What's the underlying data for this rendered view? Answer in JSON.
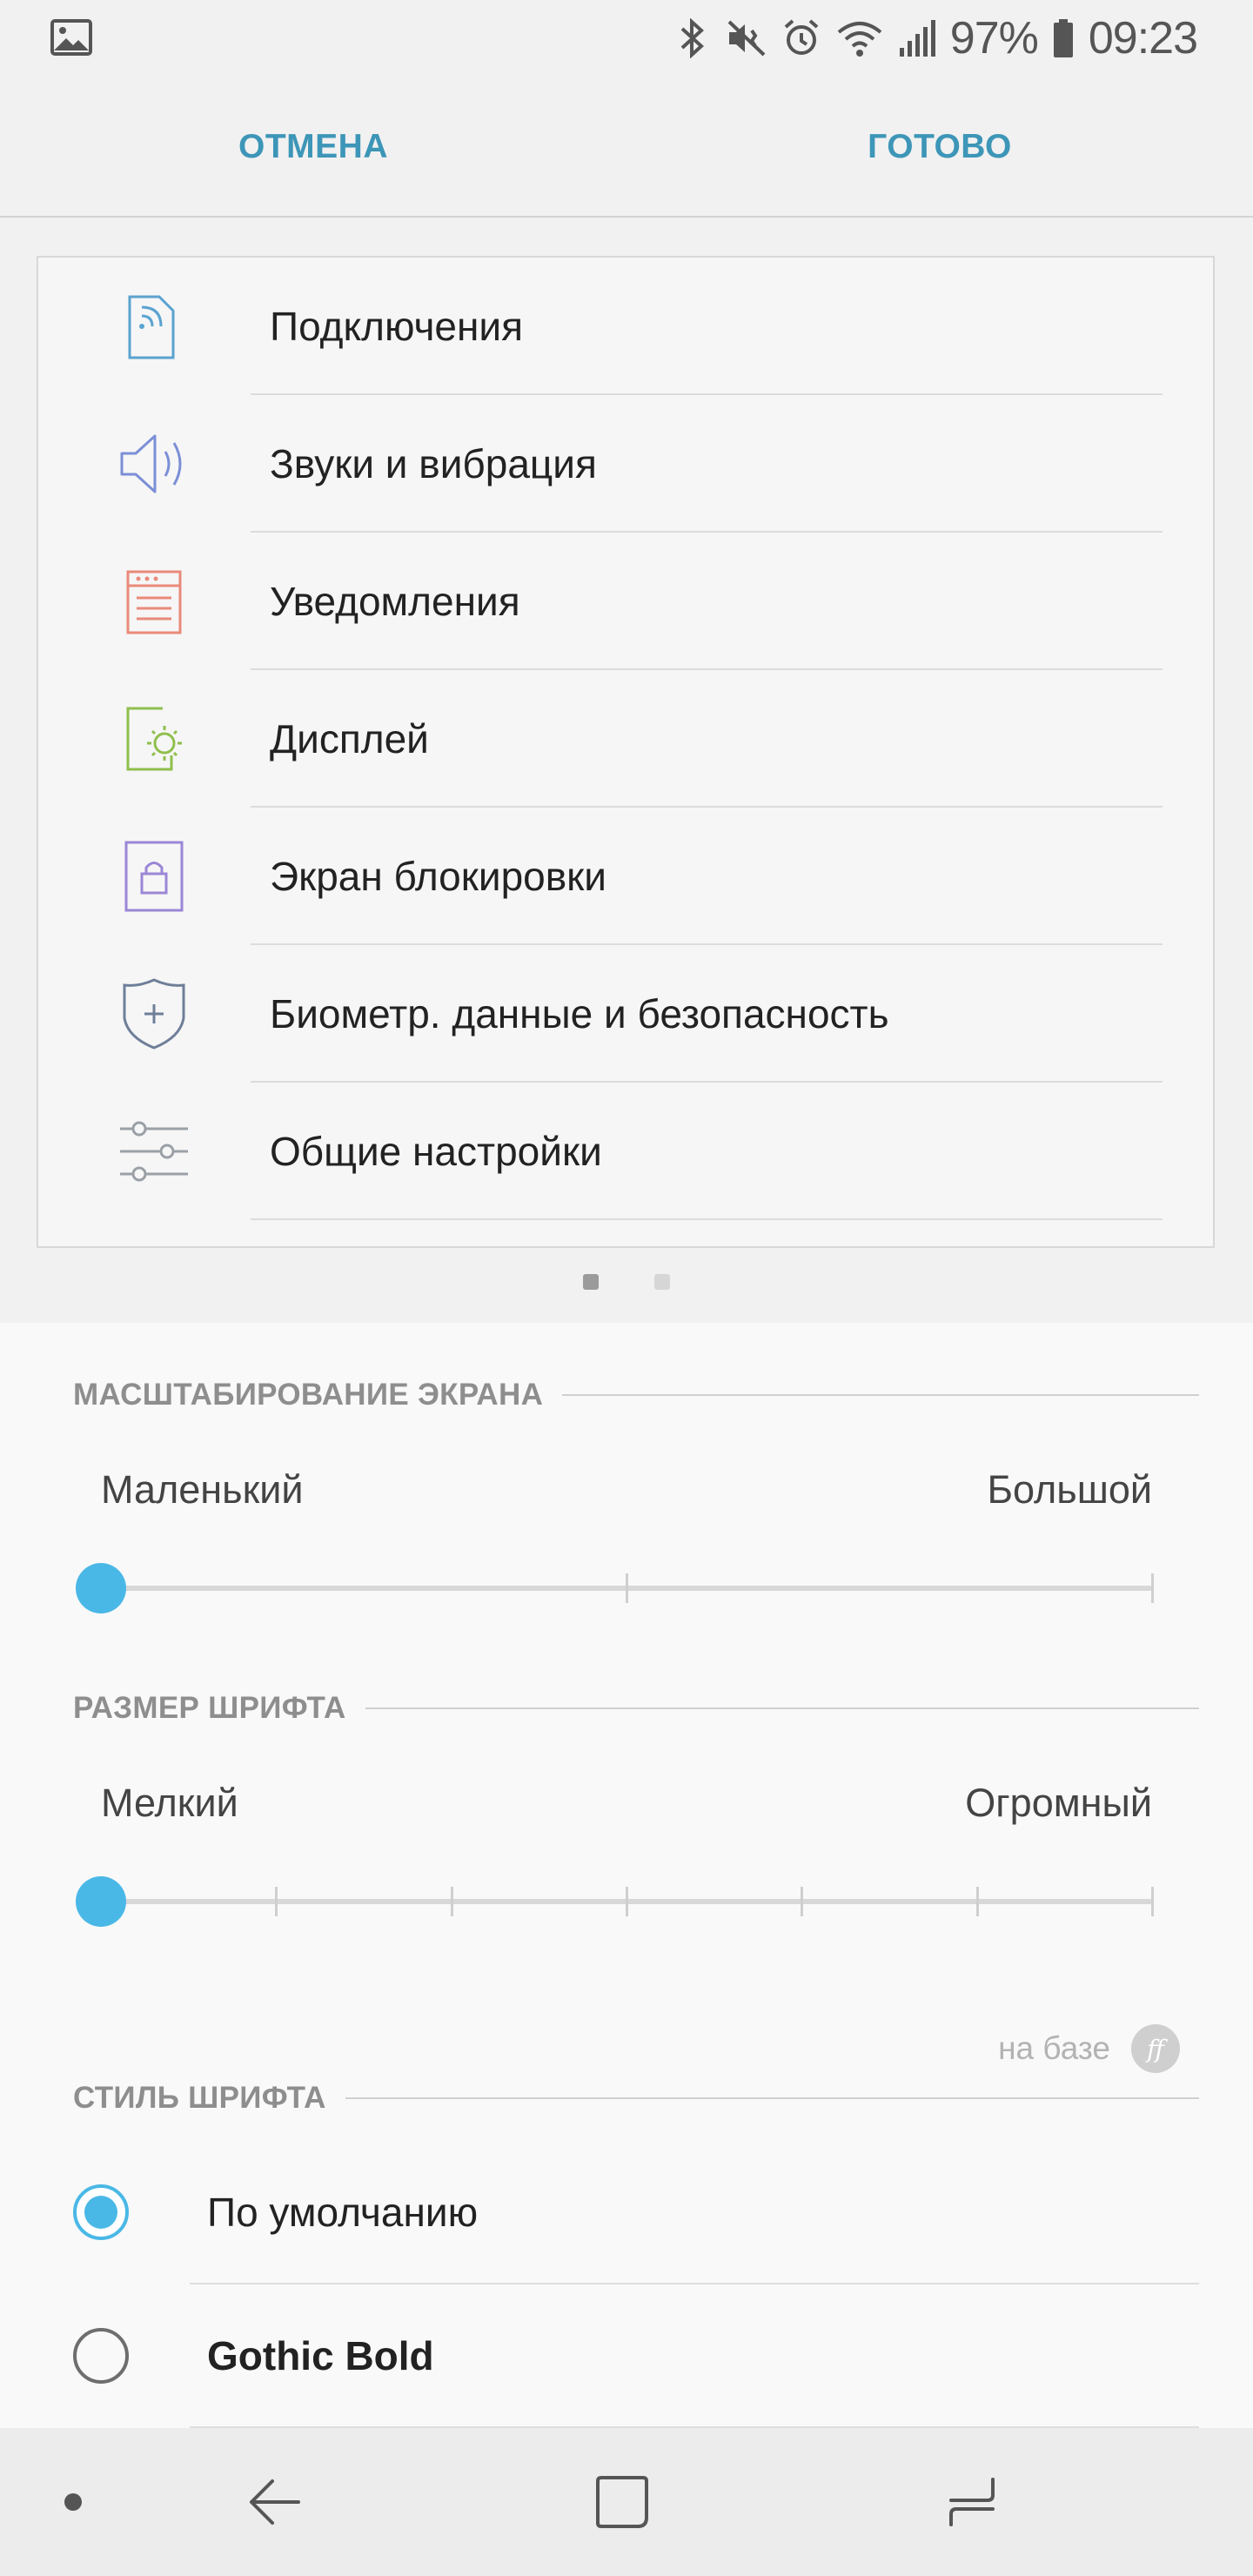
{
  "status_bar": {
    "battery_text": "97%",
    "time": "09:23",
    "icons": [
      "gallery-icon",
      "bluetooth-icon",
      "mute-vibrate-icon",
      "alarm-icon",
      "wifi-icon",
      "signal-icon",
      "battery-icon"
    ]
  },
  "action_bar": {
    "cancel_label": "ОТМЕНА",
    "done_label": "ГОТОВО",
    "accent_color": "#3d96b8"
  },
  "preview": {
    "items": [
      {
        "label": "Подключения",
        "icon": "connections-icon",
        "color": "#5aa3d0"
      },
      {
        "label": "Звуки и вибрация",
        "icon": "sound-icon",
        "color": "#7b8fd6"
      },
      {
        "label": "Уведомления",
        "icon": "notifications-icon",
        "color": "#e98a7a"
      },
      {
        "label": "Дисплей",
        "icon": "display-icon",
        "color": "#8fbf4c"
      },
      {
        "label": "Экран блокировки",
        "icon": "lock-screen-icon",
        "color": "#9b86d6"
      },
      {
        "label": "Биометр. данные и безопасность",
        "icon": "security-shield-icon",
        "color": "#6f7f99"
      },
      {
        "label": "Общие настройки",
        "icon": "general-settings-icon",
        "color": "#9aa0a6"
      }
    ],
    "pager_count": 2,
    "pager_active_index": 0
  },
  "screen_zoom": {
    "header": "МАСШТАБИРОВАНИЕ ЭКРАНА",
    "min_label": "Маленький",
    "max_label": "Большой",
    "steps": 3,
    "value_index": 0
  },
  "font_size": {
    "header": "РАЗМЕР ШРИФТА",
    "min_label": "Мелкий",
    "max_label": "Огромный",
    "steps": 7,
    "value_index": 0
  },
  "font_style": {
    "based_on_label": "на базе",
    "header": "СТИЛЬ ШРИФТА",
    "options": [
      {
        "label": "По умолчанию",
        "selected": true
      },
      {
        "label": "Gothic Bold",
        "selected": false
      }
    ]
  },
  "colors": {
    "slider_thumb": "#4ab8e6",
    "radio_selected": "#4ab8e6"
  }
}
